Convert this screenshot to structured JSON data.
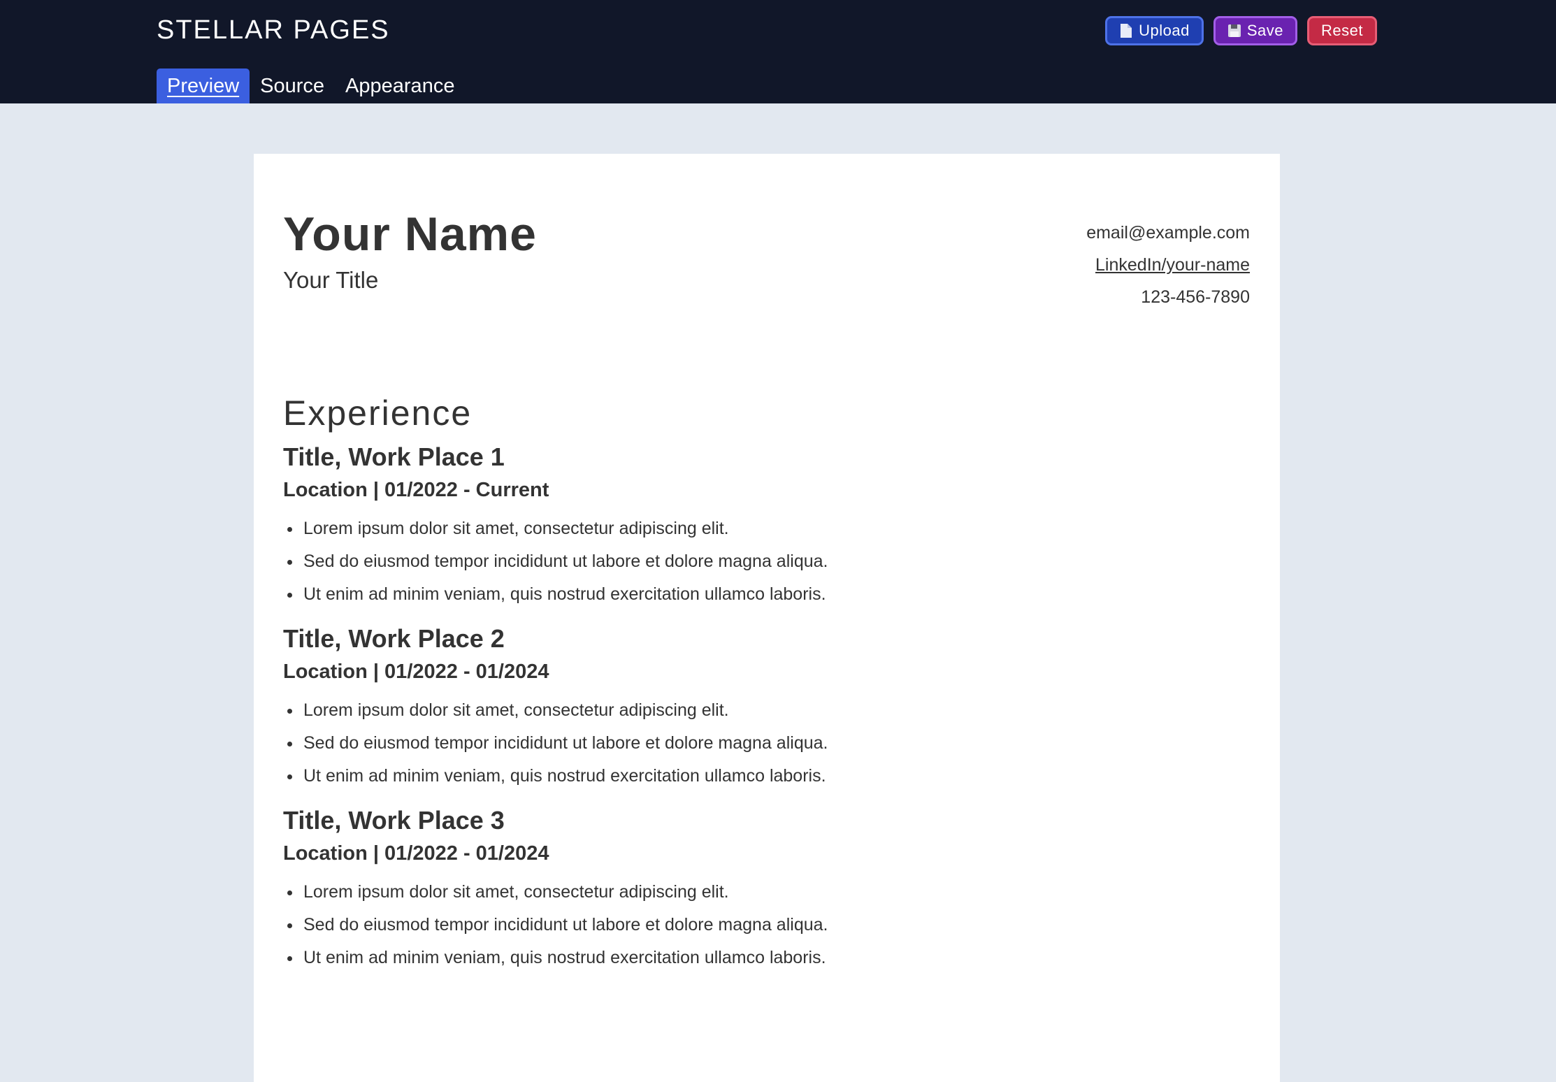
{
  "app": {
    "brand": "STELLAR PAGES"
  },
  "toolbar": {
    "upload_label": "Upload",
    "upload_icon": "document-icon",
    "save_label": "Save",
    "save_icon": "floppy-disk-icon",
    "reset_label": "Reset"
  },
  "tabs": [
    {
      "label": "Preview",
      "active": true
    },
    {
      "label": "Source",
      "active": false
    },
    {
      "label": "Appearance",
      "active": false
    }
  ],
  "resume": {
    "name": "Your Name",
    "title": "Your Title",
    "contact": {
      "email": "email@example.com",
      "linkedin": "LinkedIn/your-name",
      "phone": "123-456-7890"
    },
    "section_title": "Experience",
    "jobs": [
      {
        "title": "Title, Work Place 1",
        "meta": "Location | 01/2022 - Current",
        "bullets": [
          "Lorem ipsum dolor sit amet, consectetur adipiscing elit.",
          "Sed do eiusmod tempor incididunt ut labore et dolore magna aliqua.",
          "Ut enim ad minim veniam, quis nostrud exercitation ullamco laboris."
        ]
      },
      {
        "title": "Title, Work Place 2",
        "meta": "Location | 01/2022 - 01/2024",
        "bullets": [
          "Lorem ipsum dolor sit amet, consectetur adipiscing elit.",
          "Sed do eiusmod tempor incididunt ut labore et dolore magna aliqua.",
          "Ut enim ad minim veniam, quis nostrud exercitation ullamco laboris."
        ]
      },
      {
        "title": "Title, Work Place 3",
        "meta": "Location | 01/2022 - 01/2024",
        "bullets": [
          "Lorem ipsum dolor sit amet, consectetur adipiscing elit.",
          "Sed do eiusmod tempor incididunt ut labore et dolore magna aliqua.",
          "Ut enim ad minim veniam, quis nostrud exercitation ullamco laboris."
        ]
      }
    ]
  },
  "colors": {
    "header_bg": "#111729",
    "page_bg": "#e2e8f0",
    "active_tab": "#3b5fe0",
    "upload": "#1f3fb1",
    "save": "#6a22b0",
    "reset": "#c42a45",
    "text": "#333333"
  }
}
